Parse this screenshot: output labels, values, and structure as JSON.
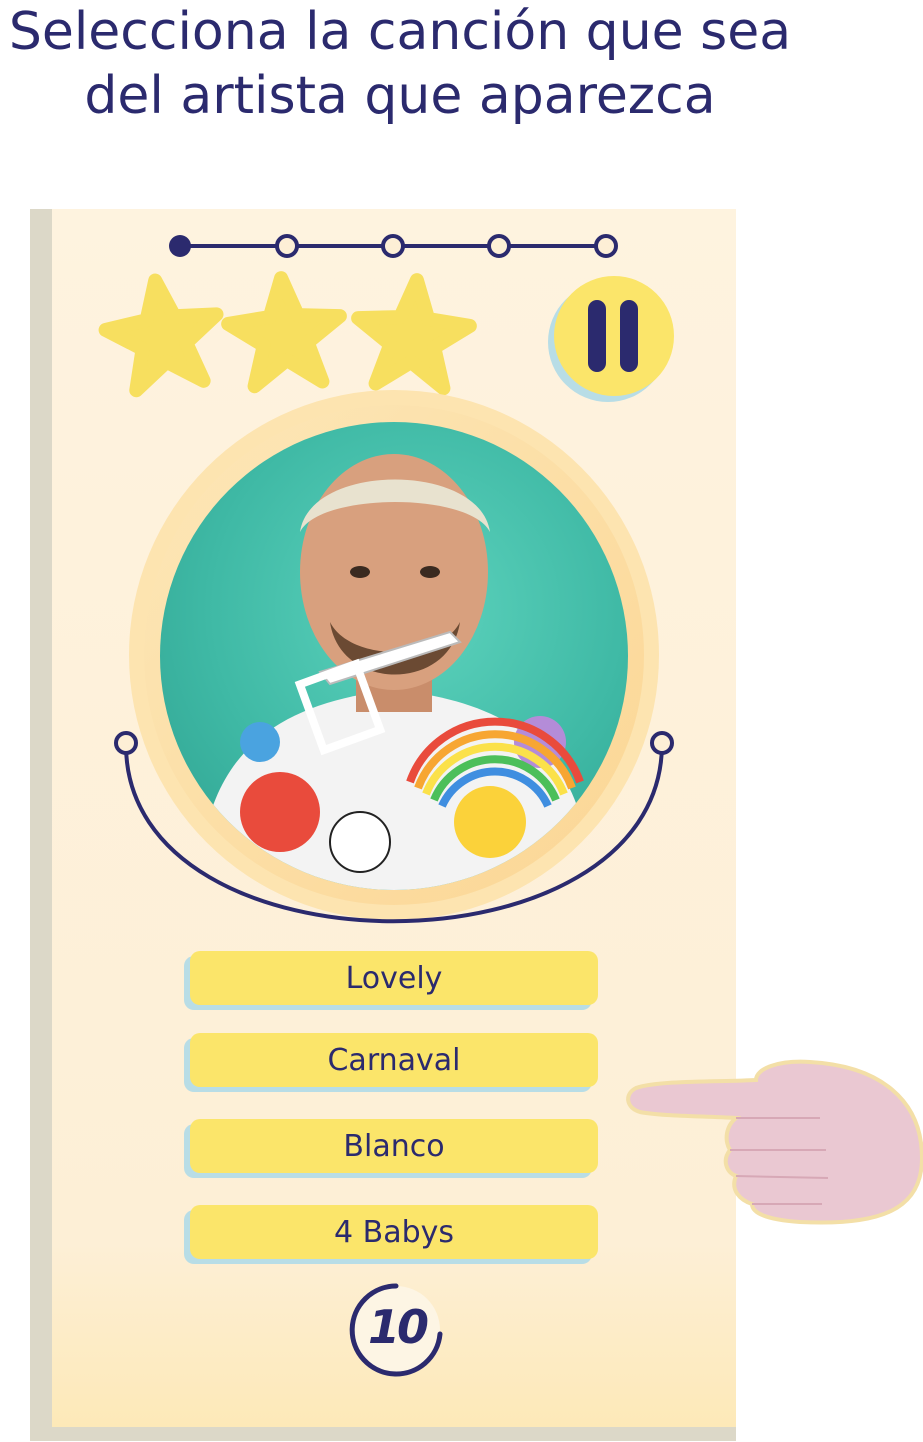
{
  "instruction": {
    "line1": "Selecciona la canción que sea",
    "line2": "del artista que aparezca"
  },
  "progress": {
    "total": 5,
    "current": 1
  },
  "stars": {
    "earned": 3,
    "total": 3
  },
  "pause_icon": "pause-icon",
  "options": [
    {
      "label": "Lovely"
    },
    {
      "label": "Carnaval"
    },
    {
      "label": "Blanco"
    },
    {
      "label": "4 Babys"
    }
  ],
  "timer": {
    "value": "10"
  },
  "pointer_icon": "pointing-hand-icon",
  "colors": {
    "card": "#fdefd6",
    "card_shadow": "#dcd8c8",
    "navy": "#2b2a6e",
    "star": "#f7df5f",
    "button": "#fbe56a",
    "button_shadow": "#b8dde6",
    "photo_bg": "#3fb9a5",
    "hand": "#eac8d2"
  }
}
